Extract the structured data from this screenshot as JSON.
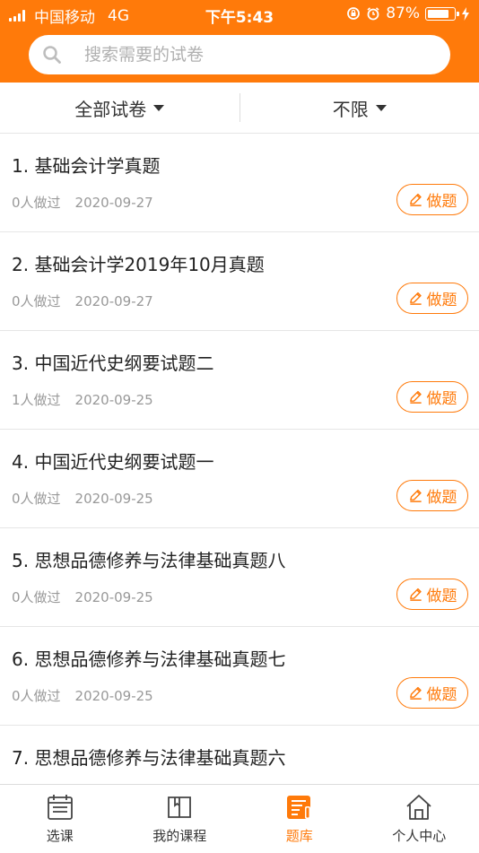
{
  "status_bar": {
    "carrier": "中国移动",
    "network": "4G",
    "time": "下午5:43",
    "battery_percent": "87%",
    "battery_level": 0.87
  },
  "search": {
    "placeholder": "搜索需要的试卷",
    "icon": "search-icon"
  },
  "filters": [
    {
      "label": "全部试卷"
    },
    {
      "label": "不限"
    }
  ],
  "exam_list": [
    {
      "title": "1. 基础会计学真题",
      "done_count": "0人做过",
      "date": "2020-09-27",
      "button": "做题"
    },
    {
      "title": "2. 基础会计学2019年10月真题",
      "done_count": "0人做过",
      "date": "2020-09-27",
      "button": "做题"
    },
    {
      "title": "3. 中国近代史纲要试题二",
      "done_count": "1人做过",
      "date": "2020-09-25",
      "button": "做题"
    },
    {
      "title": "4. 中国近代史纲要试题一",
      "done_count": "0人做过",
      "date": "2020-09-25",
      "button": "做题"
    },
    {
      "title": "5. 思想品德修养与法律基础真题八",
      "done_count": "0人做过",
      "date": "2020-09-25",
      "button": "做题"
    },
    {
      "title": "6. 思想品德修养与法律基础真题七",
      "done_count": "0人做过",
      "date": "2020-09-25",
      "button": "做题"
    },
    {
      "title": "7. 思想品德修养与法律基础真题六",
      "done_count": "",
      "date": "",
      "button": ""
    }
  ],
  "tab_bar": [
    {
      "label": "选课",
      "icon": "calendar-icon",
      "active": false
    },
    {
      "label": "我的课程",
      "icon": "book-icon",
      "active": false
    },
    {
      "label": "题库",
      "icon": "question-bank-icon",
      "active": true
    },
    {
      "label": "个人中心",
      "icon": "home-icon",
      "active": false
    }
  ],
  "colors": {
    "accent": "#ff7a0a",
    "text": "#333333",
    "muted": "#999999"
  }
}
